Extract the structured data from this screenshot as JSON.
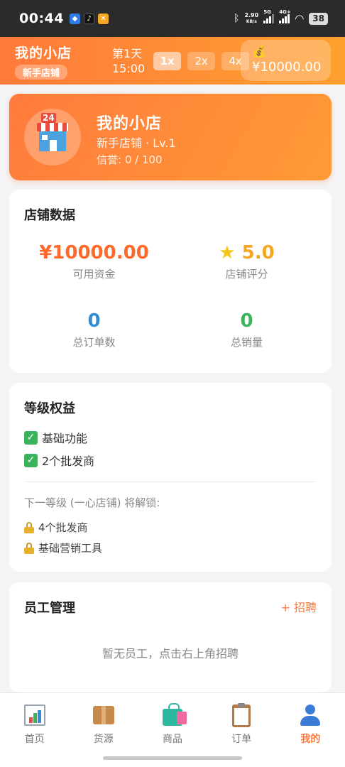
{
  "status_bar": {
    "time": "00:44",
    "net_speed_value": "2.90",
    "net_speed_unit": "KB/s",
    "signal1_label": "5G",
    "signal2_label": "4G+",
    "battery": "38"
  },
  "header": {
    "shop_name": "我的小店",
    "shop_level": "新手店铺",
    "day": "第1天",
    "clock": "15:00",
    "speeds": [
      "1x",
      "2x",
      "4x"
    ],
    "money": "¥10000.00"
  },
  "profile": {
    "name": "我的小店",
    "level_text": "新手店铺 · Lv.1",
    "credit_text": "信誉: 0 / 100"
  },
  "stats": {
    "title": "店铺数据",
    "funds_value": "¥10000.00",
    "funds_label": "可用资金",
    "rating_value": "5.0",
    "rating_label": "店铺评分",
    "orders_value": "0",
    "orders_label": "总订单数",
    "sales_value": "0",
    "sales_label": "总销量"
  },
  "perks": {
    "title": "等级权益",
    "unlocked": [
      "基础功能",
      "2个批发商"
    ],
    "next_text": "下一等级 (一心店铺) 将解锁:",
    "locked": [
      "4个批发商",
      "基础营销工具"
    ]
  },
  "staff": {
    "title": "员工管理",
    "recruit_label": "+ 招聘",
    "empty_text": "暂无员工，点击右上角招聘"
  },
  "nav": {
    "items": [
      "首页",
      "货源",
      "商品",
      "订单",
      "我的"
    ]
  },
  "colors": {
    "accent": "#ff7b3d",
    "funds": "#ff6a2b",
    "rating": "#f5a623",
    "orders": "#2e8fd8",
    "sales": "#3cb35a"
  }
}
